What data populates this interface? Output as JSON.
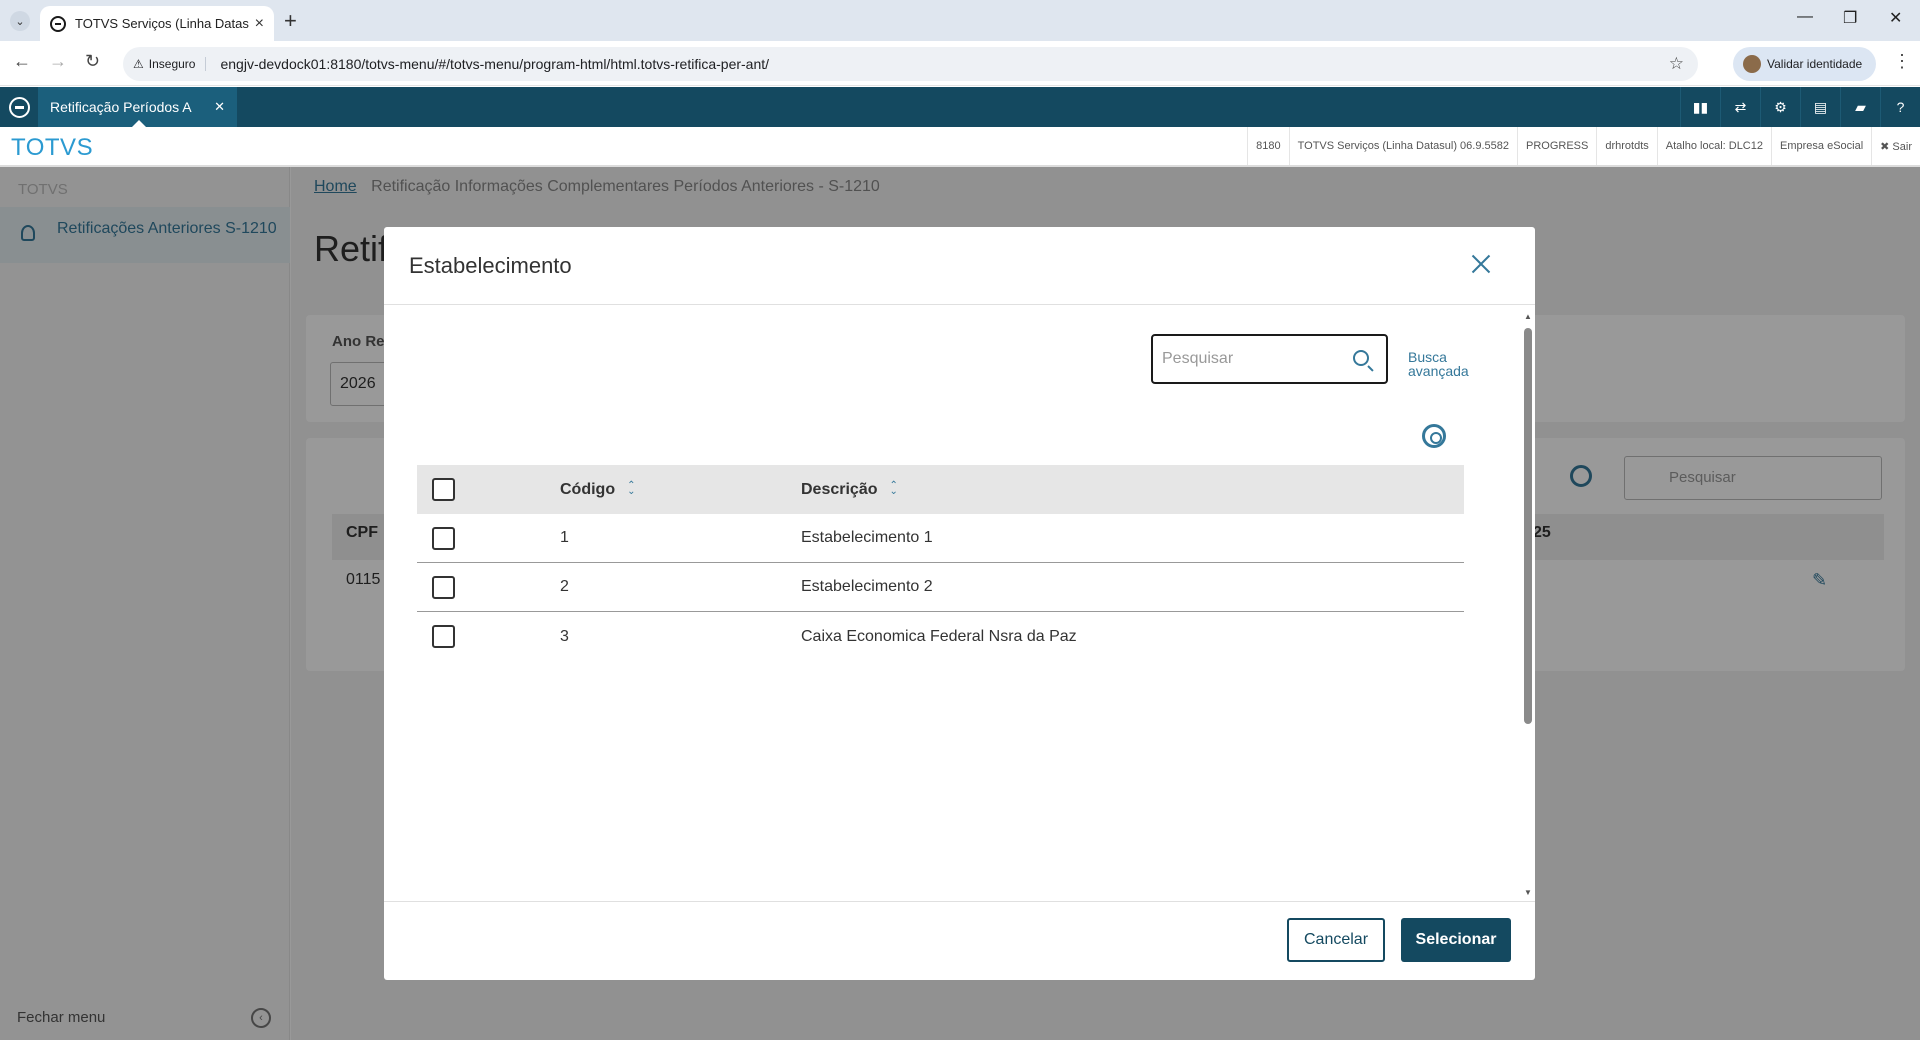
{
  "browser": {
    "tab_title": "TOTVS Serviços (Linha Datasul)",
    "security_label": "Inseguro",
    "url": "engjv-devdock01:8180/totvs-menu/#/totvs-menu/program-html/html.totvs-retifica-per-ant/",
    "identity_button": "Validar identidade"
  },
  "app": {
    "tab_title": "Retificação Períodos A",
    "brand": "TOTVS",
    "info": [
      "8180",
      "TOTVS Serviços (Linha Datasul) 06.9.5582",
      "PROGRESS",
      "drhrotdts",
      "Atalho local: DLC12",
      "Empresa eSocial"
    ],
    "logout": "✖ Sair"
  },
  "sidebar": {
    "title": "TOTVS",
    "item": "Retificações Anteriores S-1210",
    "close_menu": "Fechar menu"
  },
  "page": {
    "breadcrumb_home": "Home",
    "breadcrumb_rest": "Retificação Informações Complementares Períodos Anteriores - S-1210",
    "title": "Retif",
    "year_label": "Ano Re",
    "year_value": "2026",
    "search_placeholder": "Pesquisar",
    "col_cpf": "CPF",
    "cpf_value": "0115",
    "col_partial": "25"
  },
  "modal": {
    "title": "Estabelecimento",
    "search_placeholder": "Pesquisar",
    "advanced_search": "Busca avançada",
    "columns": {
      "code": "Código",
      "description": "Descrição"
    },
    "rows": [
      {
        "code": "1",
        "description": "Estabelecimento 1"
      },
      {
        "code": "2",
        "description": "Estabelecimento 2"
      },
      {
        "code": "3",
        "description": "Caixa Economica Federal Nsra da Paz"
      }
    ],
    "cancel": "Cancelar",
    "select": "Selecionar"
  },
  "colors": {
    "primary": "#144960",
    "link": "#35789a",
    "brand": "#2b9ad1"
  }
}
